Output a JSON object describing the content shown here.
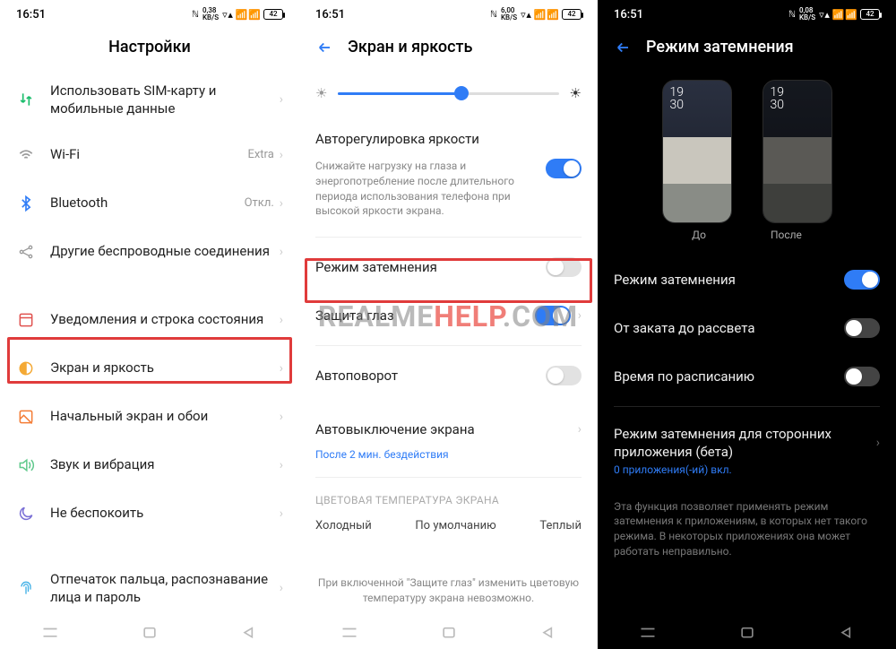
{
  "statusbar": {
    "time": "16:51",
    "battery": "42"
  },
  "net": {
    "s1": "0,38",
    "s2": "6,00",
    "s3": "0,08",
    "unit": "KB/S"
  },
  "watermark": {
    "a": "REALME",
    "b": "HELP",
    "c": ".COM"
  },
  "screen1": {
    "title": "Настройки",
    "items": [
      {
        "label": "Использовать SIM-карту и мобильные данные"
      },
      {
        "label": "Wi-Fi",
        "value": "Extra"
      },
      {
        "label": "Bluetooth",
        "value": "Откл."
      },
      {
        "label": "Другие беспроводные соединения"
      },
      {
        "label": "Уведомления и строка состояния"
      },
      {
        "label": "Экран и яркость"
      },
      {
        "label": "Начальный экран и обои"
      },
      {
        "label": "Звук и вибрация"
      },
      {
        "label": "Не беспокоить"
      },
      {
        "label": "Отпечаток пальца, распознавание лица и пароль"
      }
    ]
  },
  "screen2": {
    "title": "Экран и яркость",
    "slider_pct": 56,
    "autobright": {
      "title": "Авторегулировка яркости",
      "desc": "Снижайте нагрузку на глаза и энергопотребление после длительного периода использования телефона при высокой яркости экрана."
    },
    "dark_mode": "Режим затемнения",
    "eye": "Защита глаз",
    "autorotate": "Автоповорот",
    "autooff": {
      "title": "Автовыключение экрана",
      "val": "После 2 мин. бездействия"
    },
    "temp_section": "ЦВЕТОВАЯ ТЕМПЕРАТУРА ЭКРАНА",
    "temp": {
      "cold": "Холодный",
      "def": "По умолчанию",
      "warm": "Теплый"
    },
    "footer": "При включенной \"Защите глаз\" изменить цветовую температуру экрана невозможно."
  },
  "screen3": {
    "title": "Режим затемнения",
    "preview": {
      "before": "До",
      "after": "После",
      "time1": "19",
      "time2": "30"
    },
    "rows": {
      "dark": "Режим затемнения",
      "sunset": "От заката до рассвета",
      "schedule": "Время по расписанию"
    },
    "thirdparty": {
      "title": "Режим затемнения для сторонних приложения (бета)",
      "sub": "0 приложения(-ий) вкл."
    },
    "footer": "Эта функция позволяет применять режим затемнения к приложениям, в которых нет такого режима. В некоторых приложениях она может работать неправильно."
  }
}
